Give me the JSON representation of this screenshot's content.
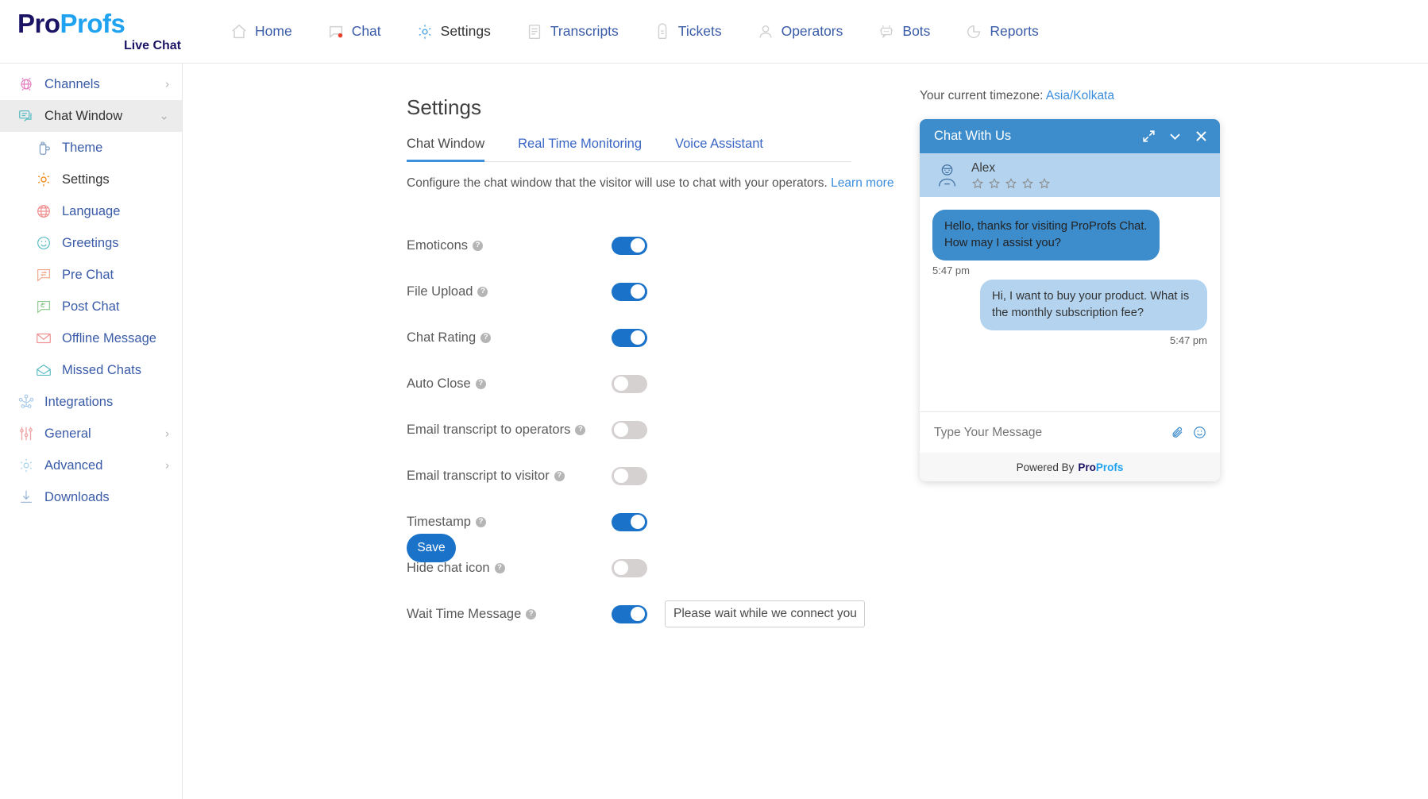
{
  "brand": {
    "logo_part1": "Pro",
    "logo_part2": "Profs",
    "logo_sub": "Live Chat"
  },
  "topnav": {
    "items": [
      {
        "label": "Home",
        "icon": "home-icon"
      },
      {
        "label": "Chat",
        "icon": "chat-bubble-icon"
      },
      {
        "label": "Settings",
        "icon": "gear-icon"
      },
      {
        "label": "Transcripts",
        "icon": "document-icon"
      },
      {
        "label": "Tickets",
        "icon": "ticket-tag-icon"
      },
      {
        "label": "Operators",
        "icon": "user-icon"
      },
      {
        "label": "Bots",
        "icon": "robot-icon"
      },
      {
        "label": "Reports",
        "icon": "pie-chart-icon"
      }
    ]
  },
  "sidebar": {
    "items": [
      {
        "label": "Channels",
        "icon": "channels-icon",
        "chevron": "›",
        "level": "top",
        "selected": false
      },
      {
        "label": "Chat Window",
        "icon": "chat-window-icon",
        "chevron": "⌄",
        "level": "top",
        "selected": true
      },
      {
        "label": "Theme",
        "icon": "theme-paint-icon",
        "level": "child",
        "selected": false
      },
      {
        "label": "Settings",
        "icon": "gear-icon",
        "level": "child",
        "selected": true
      },
      {
        "label": "Language",
        "icon": "globe-icon",
        "level": "child",
        "selected": false
      },
      {
        "label": "Greetings",
        "icon": "smiley-icon",
        "level": "child",
        "selected": false
      },
      {
        "label": "Pre Chat",
        "icon": "pre-chat-icon",
        "level": "child",
        "selected": false
      },
      {
        "label": "Post Chat",
        "icon": "post-chat-icon",
        "level": "child",
        "selected": false
      },
      {
        "label": "Offline Message",
        "icon": "envelope-icon",
        "level": "child",
        "selected": false
      },
      {
        "label": "Missed Chats",
        "icon": "open-envelope-icon",
        "level": "child",
        "selected": false
      },
      {
        "label": "Integrations",
        "icon": "integrations-icon",
        "level": "top",
        "selected": false
      },
      {
        "label": "General",
        "icon": "sliders-icon",
        "chevron": "›",
        "level": "top",
        "selected": false
      },
      {
        "label": "Advanced",
        "icon": "gear-outline-icon",
        "chevron": "›",
        "level": "top",
        "selected": false
      },
      {
        "label": "Downloads",
        "icon": "download-icon",
        "level": "top",
        "selected": false
      }
    ]
  },
  "main": {
    "page_title": "Settings",
    "tabs": [
      {
        "label": "Chat Window",
        "active": true
      },
      {
        "label": "Real Time Monitoring",
        "active": false
      },
      {
        "label": "Voice Assistant",
        "active": false
      }
    ],
    "description": "Configure the chat window that the visitor will use to chat with your operators.",
    "description_link": "Learn more",
    "help_glyph": "?",
    "settings": [
      {
        "label": "Emoticons",
        "enabled": true
      },
      {
        "label": "File Upload",
        "enabled": true
      },
      {
        "label": "Chat Rating",
        "enabled": true
      },
      {
        "label": "Auto Close",
        "enabled": false
      },
      {
        "label": "Email transcript to operators",
        "enabled": false
      },
      {
        "label": "Email transcript to visitor",
        "enabled": false
      },
      {
        "label": "Timestamp",
        "enabled": true
      },
      {
        "label": "Hide chat icon",
        "enabled": false
      },
      {
        "label": "Wait Time Message",
        "enabled": true,
        "input_value": "Please wait while we connect you to"
      }
    ],
    "save_label": "Save"
  },
  "right": {
    "timezone_prefix": "Your current timezone:",
    "timezone_value": "Asia/Kolkata",
    "widget": {
      "title": "Chat With Us",
      "operator_name": "Alex",
      "star_count": 5,
      "messages": [
        {
          "from": "operator",
          "text": "Hello, thanks for visiting ProProfs Chat. How may I assist you?",
          "time": "5:47 pm"
        },
        {
          "from": "visitor",
          "text": "Hi, I want to buy your product. What is the monthly subscription fee?",
          "time": "5:47 pm"
        }
      ],
      "input_placeholder": "Type Your Message",
      "footer_prefix": "Powered By",
      "footer_brand1": "Pro",
      "footer_brand2": "Profs"
    }
  },
  "colors": {
    "accent_blue": "#1a73c8",
    "widget_header": "#3d8ccc",
    "widget_operator_bar": "#b3d3ef",
    "nav_link": "#3a5ba8",
    "toggle_off": "#d6d1d1"
  }
}
